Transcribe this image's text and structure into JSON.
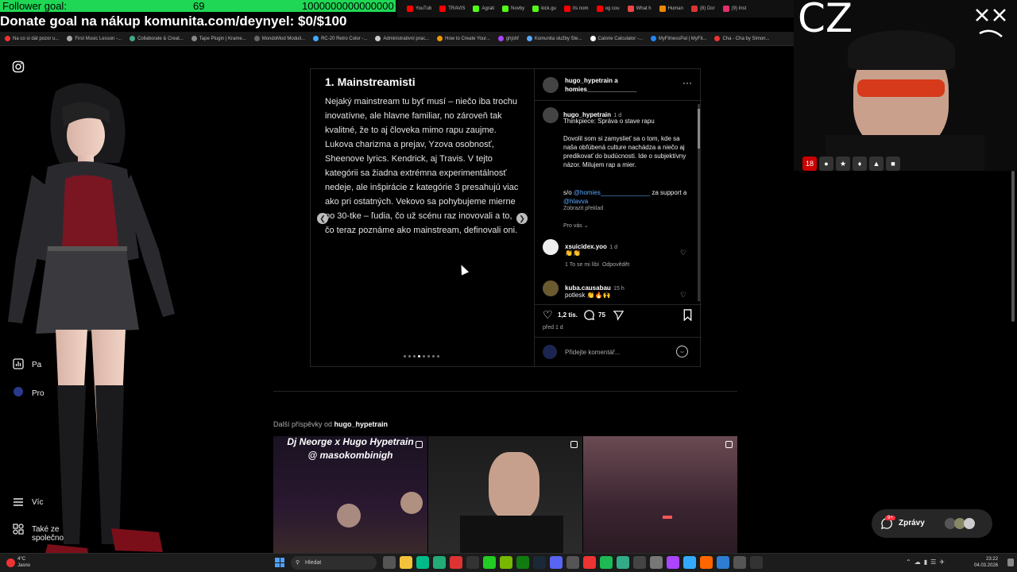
{
  "overlay": {
    "follower_label": "Follower goal:",
    "follower_current": "69",
    "follower_target": "1000000000000000",
    "donate_text": "Donate goal na nákup komunita.com/deynyel: $0/$100",
    "cam_label": "CZ"
  },
  "browser_tabs": [
    "YouTub",
    "TRAVIS",
    "Agrati",
    "Novby",
    "kick.gu",
    "Its nom",
    "og cou",
    "What h",
    "Human",
    "(8) Dor",
    "(9) Inst"
  ],
  "bookmarks": [
    "Na co si dát pozor u...",
    "First Music Lesson -...",
    "Collaborate & Creat...",
    "Tape Plugin | Krame...",
    "MondoMod Moduli...",
    "RC-20 Retro Color -...",
    "Administrativní prac...",
    "How to Create Your...",
    "ghjshf",
    "Komunita služby Ste...",
    "Calorie Calculator -...",
    "MyFitnessPal | MyFit...",
    "Cha - Cha by Simon..."
  ],
  "nav": {
    "items": [
      {
        "label": "Pa"
      },
      {
        "label": "Pro"
      },
      {
        "label": "Víc"
      },
      {
        "label": "Také ze společnost..."
      }
    ]
  },
  "post": {
    "slide_title": "1. Mainstreamisti",
    "slide_text": "Nejaký mainstream tu byť musí – niečo iba trochu inovatívne, ale hlavne familiar, no zároveň tak kvalitné, že to aj človeka mimo rapu zaujme. Lukova charizma a prejav, Yzova osobnosť, Sheenove lyrics. Kendrick, aj Travis. V tejto kategórii sa žiadna extrémna experimentálnosť nedeje, ale inšpirácie z kategórie 3 presahujú viac ako pri ostatných. Vekovo sa pohybujeme mierne po 30-tke – ľudia, čo už scénu raz inovovali a to, čo teraz poznáme ako mainstream, definovali oni.",
    "header_user": "hugo_hypetrain a",
    "header_coauthor": "homies______________",
    "caption_user": "hugo_hypetrain",
    "caption_time": "1 d",
    "caption_title": "Thinkpiece: Správa o stave rapu",
    "caption_body": "Dovolil som si zamyslieť sa o tom, kde sa naša obľúbená culture nachádza a niečo aj predikovať do budúcnosti. Ide o subjektívny názor. Milujem rap a mier.",
    "credit_prefix": "s/o",
    "credit_mention1": "@homies______________",
    "credit_mid": "za support a",
    "credit_mention2": "@hlavva",
    "translate": "Zobrazit překlad",
    "for_you": "Pro vás",
    "comments": [
      {
        "user": "xsuicidex.yoo",
        "time": "1 d",
        "text": "👏👏",
        "likes": "1 To se mi líbí",
        "reply": "Odpovědět"
      },
      {
        "user": "kuba.causabau",
        "time": "15 h",
        "text": "potlesk 👏🔥🙌"
      }
    ],
    "like_count": "1,2 tis.",
    "comment_count": "75",
    "posted": "před 1 d",
    "comment_placeholder": "Přidejte komentář..."
  },
  "more": {
    "label_prefix": "Další příspěvky od",
    "label_user": "hugo_hypetrain",
    "thumb1_text_line1": "Dj Neorge x Hugo Hypetrain",
    "thumb1_text_line2": "@ masokombinigh"
  },
  "messages": {
    "label": "Zprávy",
    "badge": "9+"
  },
  "cam_badge_age": "18",
  "taskbar": {
    "weather_temp": "4°C",
    "weather_desc": "Jasno",
    "search": "Hledat",
    "time": "23:22",
    "date": "04.03.2026"
  },
  "colors": {
    "follower_bar": "#1fd655",
    "link": "#5aa7ff",
    "badge": "#ff3040"
  }
}
